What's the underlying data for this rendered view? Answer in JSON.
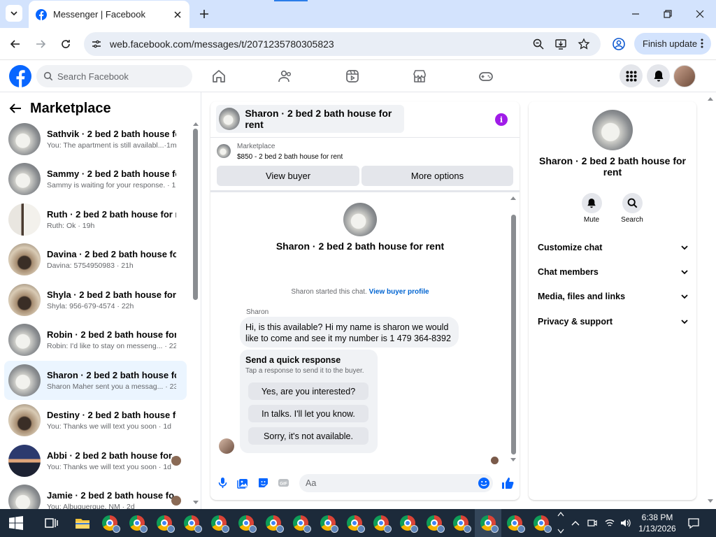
{
  "browser": {
    "tab_title": "Messenger | Facebook",
    "url": "web.facebook.com/messages/t/2071235780305823",
    "finish_update_label": "Finish update"
  },
  "fb": {
    "search_placeholder": "Search Facebook"
  },
  "sidebar": {
    "title": "Marketplace",
    "conversations": [
      {
        "name": "Sathvik · 2 bed 2 bath house for...",
        "preview": "You: The apartment is still availabl...·1m"
      },
      {
        "name": "Sammy · 2 bed 2 bath house for...",
        "preview": "Sammy is waiting for your response. · 1h"
      },
      {
        "name": "Ruth · 2 bed 2 bath house for re...",
        "preview": "Ruth: Ok · 19h"
      },
      {
        "name": "Davina · 2 bed 2 bath house for...",
        "preview": "Davina: 5754950983 · 21h"
      },
      {
        "name": "Shyla · 2 bed 2 bath house for r...",
        "preview": "Shyla: 956-679-4574 · 22h"
      },
      {
        "name": "Robin · 2 bed 2 bath house for r...",
        "preview": "Robin: I'd like to stay on messeng... · 22h"
      },
      {
        "name": "Sharon · 2 bed 2 bath house for...",
        "preview": "Sharon Maher sent you a messag... · 23h"
      },
      {
        "name": "Destiny · 2 bed 2 bath house fo...",
        "preview": "You: Thanks we will text you soon · 1d"
      },
      {
        "name": "Abbi · 2 bed 2 bath house for...",
        "preview": "You: Thanks we will text you soon · 1d"
      },
      {
        "name": "Jamie · 2 bed 2 bath house fo...",
        "preview": "You: Albuquerque, NM · 2d"
      }
    ]
  },
  "chat": {
    "header_title": "Sharon · 2 bed 2 bath house for rent",
    "marketplace_label": "Marketplace",
    "listing_price": "$850 - 2 bed 2 bath house for rent",
    "view_buyer": "View buyer",
    "more_options": "More options",
    "intro_name": "Sharon · 2 bed 2 bath house for rent",
    "started_text": "Sharon started this chat.",
    "view_buyer_profile": "View buyer profile",
    "sender": "Sharon",
    "message": "Hi, is this available? Hi my name is sharon we would like to come and see it my number is 1 479 364-8392",
    "quick_title": "Send a quick response",
    "quick_sub": "Tap a response to send it to the buyer.",
    "quick_options": [
      "Yes, are you interested?",
      "In talks. I'll let you know.",
      "Sorry, it's not available."
    ],
    "composer_placeholder": "Aa"
  },
  "details": {
    "name": "Sharon · 2 bed 2 bath house for rent",
    "mute": "Mute",
    "search": "Search",
    "sections": [
      "Customize chat",
      "Chat members",
      "Media, files and links",
      "Privacy & support"
    ]
  },
  "taskbar": {
    "time": "6:38 PM",
    "date": "1/13/2026"
  },
  "colors": {
    "fb_blue": "#0866ff",
    "selected_row": "#ebf5ff",
    "info_purple": "#a01ce8"
  }
}
